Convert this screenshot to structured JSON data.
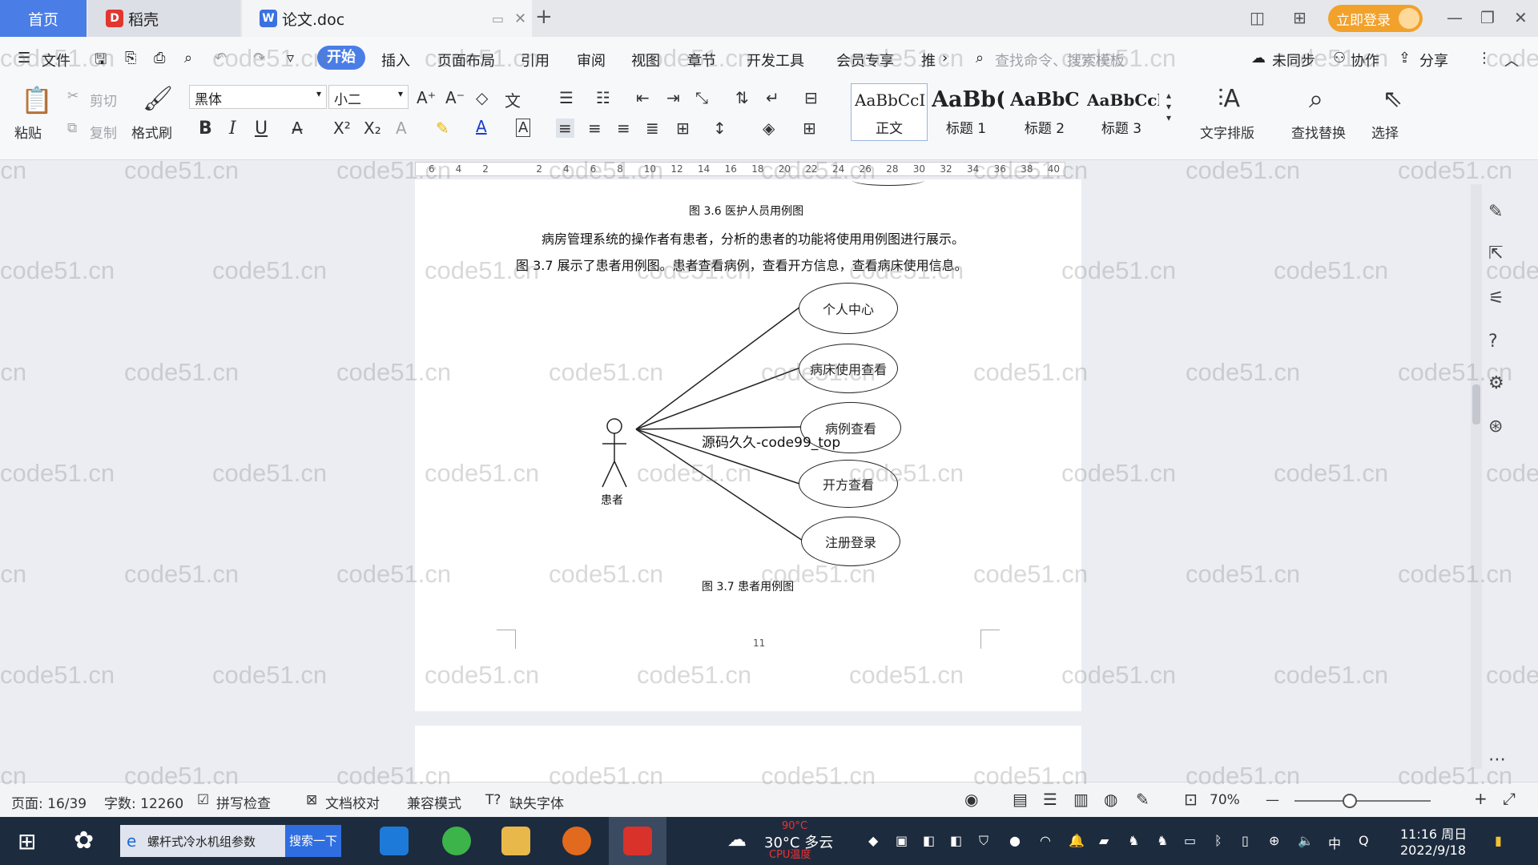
{
  "titlebar": {
    "tabs": [
      {
        "label": "首页"
      },
      {
        "label": "稻壳"
      },
      {
        "label": "论文.doc"
      }
    ],
    "login": "立即登录"
  },
  "menu": {
    "file": "文件",
    "items": [
      "开始",
      "插入",
      "页面布局",
      "引用",
      "审阅",
      "视图",
      "章节",
      "开发工具",
      "会员专享",
      "推"
    ],
    "search_cmd": "查找命令、搜索模板",
    "sync": "未同步",
    "collab": "协作",
    "share": "分享"
  },
  "toolbar": {
    "paste": "粘贴",
    "cut": "剪切",
    "copy": "复制",
    "format_painter": "格式刷",
    "font": "黑体",
    "size": "小二",
    "styles": [
      {
        "sample": "AaBbCcI",
        "name": "正文"
      },
      {
        "sample": "AaBb(",
        "name": "标题 1"
      },
      {
        "sample": "AaBbC",
        "name": "标题 2"
      },
      {
        "sample": "AaBbCcl",
        "name": "标题 3"
      }
    ],
    "text_layout": "文字排版",
    "find_replace": "查找替换",
    "select": "选择"
  },
  "ruler": [
    "6",
    "4",
    "2",
    "",
    "2",
    "4",
    "6",
    "8",
    "10",
    "12",
    "14",
    "16",
    "18",
    "20",
    "22",
    "24",
    "26",
    "28",
    "30",
    "32",
    "34",
    "36",
    "38",
    "40"
  ],
  "document": {
    "caption_36": "图 3.6  医护人员用例图",
    "para1": "病房管理系统的操作者有患者，分析的患者的功能将使用用例图进行展示。",
    "para2": "图 3.7 展示了患者用例图。患者查看病例，查看开方信息，查看病床使用信息。",
    "actor": "患者",
    "usecases": [
      "个人中心",
      "病床使用查看",
      "病例查看",
      "开方查看",
      "注册登录"
    ],
    "overlay": "源码久久-code99_top",
    "caption_37": "图 3.7  患者用例图",
    "page_number": "11"
  },
  "statusbar": {
    "page": "页面: 16/39",
    "words": "字数: 12260",
    "spell": "拼写检查",
    "proof": "文档校对",
    "compat": "兼容模式",
    "missing_font": "缺失字体",
    "zoom": "70%"
  },
  "taskbar": {
    "search_text": "螺杆式冷水机组参数",
    "search_btn": "搜索一下",
    "weather": "30°C 多云",
    "cpu_temp": "90°C",
    "cpu_label": "CPU温度",
    "ime": "中",
    "time": "11:16 周日",
    "date": "2022/9/18"
  },
  "watermark": "code51.cn"
}
